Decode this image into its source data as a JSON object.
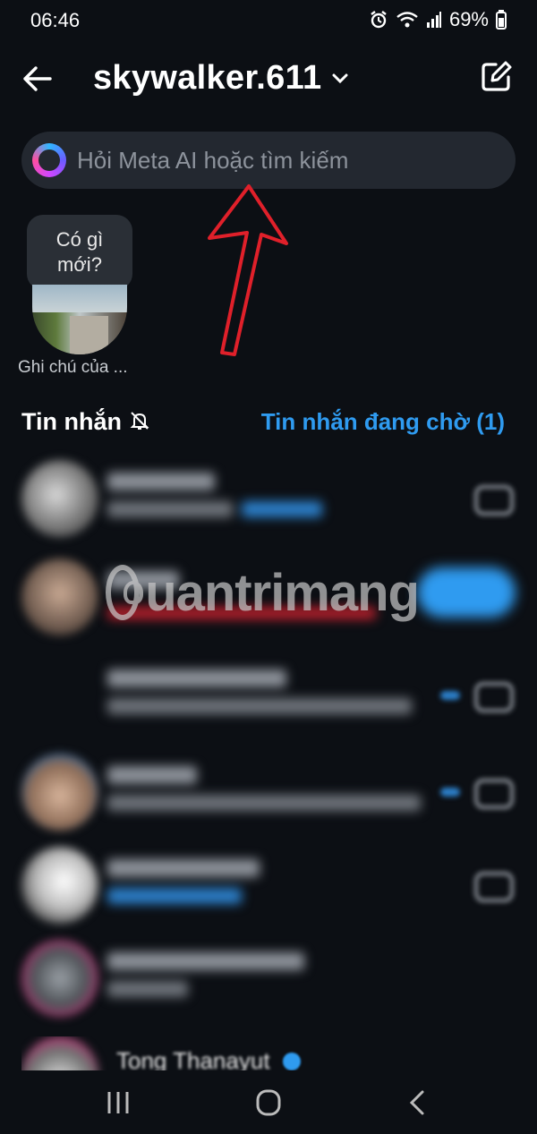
{
  "status": {
    "time": "06:46",
    "battery": "69%"
  },
  "header": {
    "username": "skywalker.611"
  },
  "search": {
    "placeholder": "Hỏi Meta AI hoặc tìm kiếm"
  },
  "note": {
    "bubble_line1": "Có gì",
    "bubble_line2": "mới?",
    "caption": "Ghi chú của ..."
  },
  "messages": {
    "title": "Tin nhắn",
    "requests_label": "Tin nhắn đang chờ (1)"
  },
  "partial_contact": {
    "name": "Tong Thanayut"
  },
  "watermark": {
    "text": "uantrimang"
  },
  "colors": {
    "accent": "#2f9bf0",
    "background": "#0c0f14",
    "search_bg": "#232830",
    "annotation_arrow": "#e0202a"
  },
  "icons": {
    "back": "arrow-left-icon",
    "dropdown": "chevron-down-icon",
    "compose": "compose-icon",
    "meta_ai": "meta-ai-ring-icon",
    "mute": "bell-off-icon",
    "camera": "camera-icon"
  }
}
